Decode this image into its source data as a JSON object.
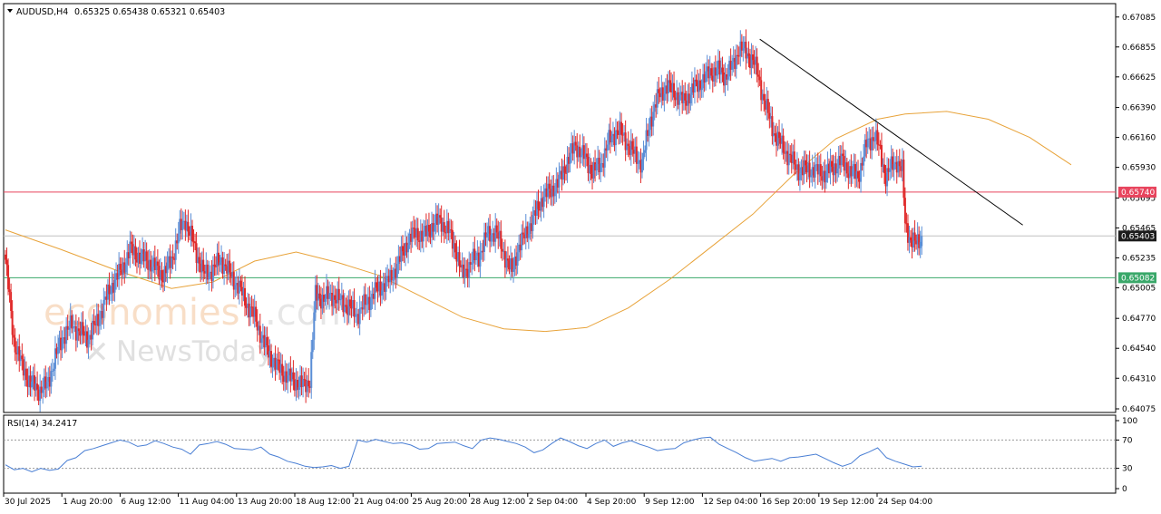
{
  "chart_data": [
    {
      "type": "candlestick",
      "symbol_header": "AUDUSD,H4",
      "ohlc_header": "0.65325 0.65438 0.65321 0.65403",
      "last_values": {
        "open": 0.65325,
        "high": 0.65438,
        "low": 0.65321,
        "close": 0.65403
      },
      "y_ticks": [
        "0.67085",
        "0.66855",
        "0.66625",
        "0.66390",
        "0.66160",
        "0.65930",
        "0.65695",
        "0.65465",
        "0.65235",
        "0.65005",
        "0.64770",
        "0.64540",
        "0.64310",
        "0.64075"
      ],
      "ylim": [
        0.64075,
        0.6716
      ],
      "x_labels": [
        "30 Jul 2025",
        "1 Aug 20:00",
        "6 Aug 12:00",
        "11 Aug 04:00",
        "13 Aug 20:00",
        "18 Aug 12:00",
        "21 Aug 04:00",
        "25 Aug 20:00",
        "28 Aug 12:00",
        "2 Sep 04:00",
        "4 Sep 20:00",
        "9 Sep 12:00",
        "12 Sep 04:00",
        "16 Sep 20:00",
        "19 Sep 12:00",
        "24 Sep 04:00"
      ],
      "levels": [
        {
          "label": "0.65740",
          "value": 0.6574,
          "color": "#e8455e"
        },
        {
          "label": "0.65403",
          "value": 0.65403,
          "color": "#c0c0c0"
        },
        {
          "label": "0.65082",
          "value": 0.65082,
          "color": "#3aa86a"
        }
      ],
      "close_path": [
        [
          0,
          0.6522
        ],
        [
          6,
          0.646
        ],
        [
          12,
          0.644
        ],
        [
          18,
          0.6427
        ],
        [
          24,
          0.6422
        ],
        [
          30,
          0.6425
        ],
        [
          36,
          0.6447
        ],
        [
          42,
          0.6464
        ],
        [
          48,
          0.6472
        ],
        [
          54,
          0.6466
        ],
        [
          60,
          0.6462
        ],
        [
          66,
          0.6474
        ],
        [
          72,
          0.649
        ],
        [
          78,
          0.6505
        ],
        [
          84,
          0.6514
        ],
        [
          90,
          0.653
        ],
        [
          96,
          0.6525
        ],
        [
          102,
          0.6522
        ],
        [
          108,
          0.6516
        ],
        [
          114,
          0.651
        ],
        [
          120,
          0.6522
        ],
        [
          126,
          0.6545
        ],
        [
          130,
          0.6553
        ],
        [
          134,
          0.654
        ],
        [
          138,
          0.6527
        ],
        [
          144,
          0.651
        ],
        [
          150,
          0.6515
        ],
        [
          156,
          0.6522
        ],
        [
          162,
          0.6511
        ],
        [
          168,
          0.6502
        ],
        [
          174,
          0.6489
        ],
        [
          180,
          0.6478
        ],
        [
          186,
          0.646
        ],
        [
          192,
          0.6446
        ],
        [
          198,
          0.6438
        ],
        [
          204,
          0.6432
        ],
        [
          210,
          0.6428
        ],
        [
          216,
          0.6425
        ],
        [
          220,
          0.643
        ],
        [
          224,
          0.6495
        ],
        [
          230,
          0.6492
        ],
        [
          236,
          0.6495
        ],
        [
          242,
          0.649
        ],
        [
          248,
          0.6486
        ],
        [
          254,
          0.648
        ],
        [
          260,
          0.6488
        ],
        [
          266,
          0.6496
        ],
        [
          272,
          0.6502
        ],
        [
          278,
          0.6507
        ],
        [
          284,
          0.652
        ],
        [
          290,
          0.6535
        ],
        [
          296,
          0.6543
        ],
        [
          302,
          0.654
        ],
        [
          308,
          0.6548
        ],
        [
          314,
          0.6552
        ],
        [
          320,
          0.6544
        ],
        [
          326,
          0.6528
        ],
        [
          330,
          0.651
        ],
        [
          336,
          0.652
        ],
        [
          342,
          0.6525
        ],
        [
          348,
          0.6541
        ],
        [
          354,
          0.6544
        ],
        [
          358,
          0.6533
        ],
        [
          362,
          0.6522
        ],
        [
          366,
          0.6512
        ],
        [
          370,
          0.653
        ],
        [
          376,
          0.6542
        ],
        [
          382,
          0.6555
        ],
        [
          388,
          0.657
        ],
        [
          394,
          0.6575
        ],
        [
          400,
          0.6582
        ],
        [
          406,
          0.6598
        ],
        [
          412,
          0.661
        ],
        [
          418,
          0.6601
        ],
        [
          424,
          0.659
        ],
        [
          430,
          0.6595
        ],
        [
          436,
          0.6613
        ],
        [
          442,
          0.6622
        ],
        [
          448,
          0.6614
        ],
        [
          454,
          0.6603
        ],
        [
          460,
          0.6596
        ],
        [
          466,
          0.663
        ],
        [
          472,
          0.6648
        ],
        [
          478,
          0.6655
        ],
        [
          484,
          0.665
        ],
        [
          490,
          0.6643
        ],
        [
          496,
          0.6652
        ],
        [
          502,
          0.6658
        ],
        [
          508,
          0.6665
        ],
        [
          514,
          0.6668
        ],
        [
          520,
          0.6663
        ],
        [
          526,
          0.6672
        ],
        [
          530,
          0.6685
        ],
        [
          536,
          0.668
        ],
        [
          540,
          0.6676
        ],
        [
          544,
          0.6662
        ],
        [
          548,
          0.6645
        ],
        [
          552,
          0.663
        ],
        [
          556,
          0.6618
        ],
        [
          562,
          0.6608
        ],
        [
          568,
          0.6598
        ],
        [
          574,
          0.659
        ],
        [
          580,
          0.6592
        ],
        [
          586,
          0.659
        ],
        [
          592,
          0.6588
        ],
        [
          598,
          0.6593
        ],
        [
          604,
          0.6598
        ],
        [
          610,
          0.659
        ],
        [
          616,
          0.6586
        ],
        [
          622,
          0.661
        ],
        [
          628,
          0.6618
        ],
        [
          632,
          0.6604
        ],
        [
          636,
          0.6586
        ],
        [
          640,
          0.6593
        ],
        [
          644,
          0.6598
        ],
        [
          648,
          0.659
        ],
        [
          650,
          0.655
        ],
        [
          654,
          0.6537
        ],
        [
          658,
          0.6534
        ],
        [
          662,
          0.654
        ]
      ],
      "ma_series": {
        "color": "#e8a33a",
        "values": [
          [
            0,
            0.6545
          ],
          [
            40,
            0.653
          ],
          [
            80,
            0.6514
          ],
          [
            120,
            0.65
          ],
          [
            150,
            0.6505
          ],
          [
            180,
            0.6521
          ],
          [
            210,
            0.6528
          ],
          [
            240,
            0.652
          ],
          [
            270,
            0.651
          ],
          [
            300,
            0.6494
          ],
          [
            330,
            0.6478
          ],
          [
            360,
            0.6469
          ],
          [
            390,
            0.6467
          ],
          [
            420,
            0.647
          ],
          [
            450,
            0.6485
          ],
          [
            480,
            0.6507
          ],
          [
            510,
            0.6532
          ],
          [
            540,
            0.6557
          ],
          [
            570,
            0.6588
          ],
          [
            600,
            0.6615
          ],
          [
            630,
            0.663
          ],
          [
            650,
            0.6634
          ],
          [
            680,
            0.6636
          ],
          [
            710,
            0.663
          ],
          [
            740,
            0.6616
          ],
          [
            770,
            0.6595
          ]
        ]
      },
      "trendline": {
        "color": "#000000",
        "from": [
          545,
          0.66915
        ],
        "to": [
          735,
          0.65487
        ]
      },
      "bull_color": "#5b8ed6",
      "bear_color": "#e02828"
    },
    {
      "type": "line",
      "indicator_label": "RSI(14) 34.2417",
      "y_ticks": [
        "100",
        "70",
        "30",
        "0"
      ],
      "ylim": [
        0,
        100
      ],
      "levels": [
        70,
        30
      ],
      "series": [
        {
          "color": "#4a7fd4",
          "values": [
            35,
            28,
            30,
            25,
            30,
            27,
            29,
            41,
            45,
            55,
            58,
            62,
            66,
            70,
            67,
            61,
            63,
            69,
            65,
            60,
            57,
            50,
            63,
            65,
            68,
            64,
            58,
            57,
            56,
            60,
            50,
            46,
            40,
            37,
            33,
            31,
            32,
            34,
            30,
            33,
            70,
            67,
            71,
            68,
            65,
            66,
            63,
            57,
            58,
            65,
            66,
            67,
            62,
            58,
            70,
            73,
            71,
            68,
            65,
            60,
            52,
            56,
            65,
            73,
            68,
            62,
            58,
            65,
            70,
            61,
            66,
            69,
            64,
            60,
            55,
            57,
            58,
            66,
            70,
            73,
            74,
            64,
            58,
            52,
            45,
            40,
            42,
            44,
            40,
            45,
            46,
            48,
            50,
            44,
            38,
            33,
            37,
            48,
            53,
            59,
            45,
            40,
            36,
            32,
            33
          ]
        }
      ]
    }
  ],
  "brand": {
    "word1": "economies",
    "word2": ".com",
    "word3": "NewsToday"
  }
}
